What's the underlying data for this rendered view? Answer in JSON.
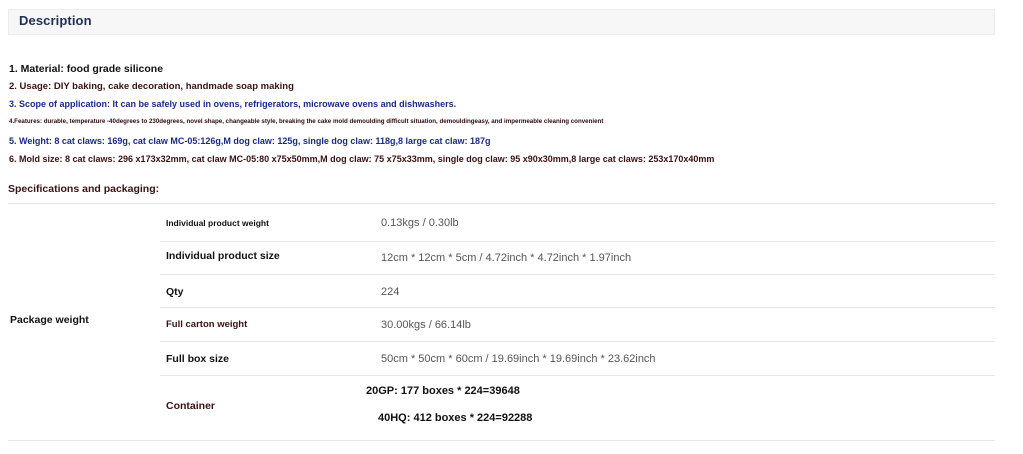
{
  "description": {
    "title": "Description"
  },
  "features": [
    "1. Material: food grade silicone",
    "2. Usage: DIY baking, cake decoration, handmade soap making",
    "3. Scope of application: It can be safely used in ovens, refrigerators, microwave ovens and dishwashers.",
    "4.Features: durable, temperature -40degrees to 230degrees, novel shape, changeable style, breaking the cake mold demoulding difficult situation, demouldingeasy, and impermeable cleaning convenient",
    "5. Weight: 8 cat claws: 169g, cat claw MC-05:126g,M dog claw: 125g, single dog claw: 118g,8 large cat claw: 187g",
    "6. Mold size: 8 cat claws: 296 x173x32mm, cat claw MC-05:80 x75x50mm,M dog claw: 75 x75x33mm, single dog claw: 95 x90x30mm,8 large cat claws: 253x170x40mm"
  ],
  "specs": {
    "heading": "Specifications and packaging:",
    "group_label": "Package weight",
    "rows": [
      {
        "label": "Individual product weight",
        "value": "0.13kgs / 0.30lb"
      },
      {
        "label": "Individual product size",
        "value": "12cm * 12cm * 5cm / 4.72inch * 4.72inch * 1.97inch"
      },
      {
        "label": "Qty",
        "value": "224"
      },
      {
        "label": "Full carton weight",
        "value": "30.00kgs / 66.14lb"
      },
      {
        "label": "Full box size",
        "value": "50cm * 50cm * 60cm / 19.69inch * 19.69inch * 23.62inch"
      }
    ],
    "container": {
      "label": "Container",
      "values": [
        "20GP: 177 boxes * 224=39648",
        "40HQ: 412 boxes * 224=92288"
      ]
    }
  }
}
